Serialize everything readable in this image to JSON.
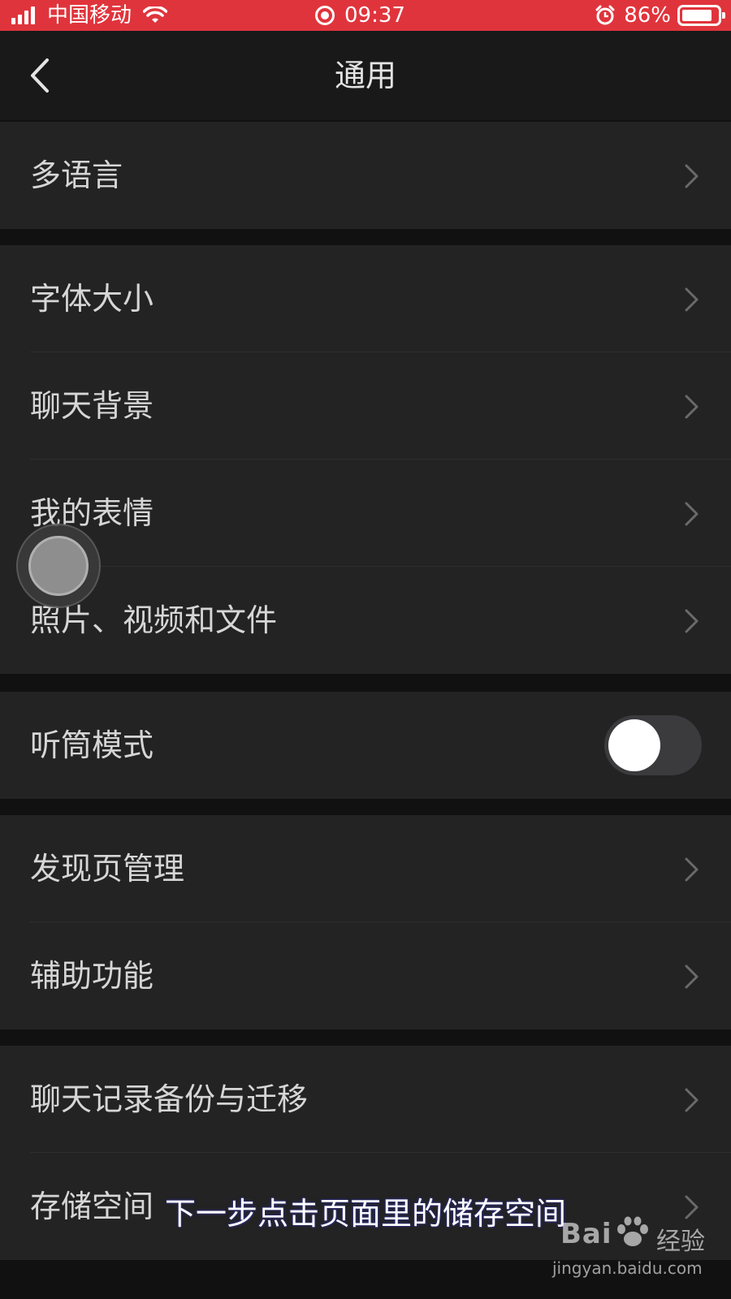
{
  "status_bar": {
    "carrier": "中国移动",
    "time": "09:37",
    "battery": "86%",
    "battery_level": 0.86
  },
  "nav": {
    "title": "通用"
  },
  "groups": [
    {
      "items": [
        {
          "label": "多语言"
        }
      ]
    },
    {
      "items": [
        {
          "label": "字体大小"
        },
        {
          "label": "聊天背景"
        },
        {
          "label": "我的表情"
        },
        {
          "label": "照片、视频和文件"
        }
      ]
    },
    {
      "items": [
        {
          "label": "听筒模式",
          "toggle": false
        }
      ]
    },
    {
      "items": [
        {
          "label": "发现页管理"
        },
        {
          "label": "辅助功能"
        }
      ]
    },
    {
      "items": [
        {
          "label": "聊天记录备份与迁移"
        },
        {
          "label": "存储空间"
        }
      ]
    }
  ],
  "caption": "下一步点击页面里的储存空间",
  "watermark": {
    "brand": "Bai",
    "suffix": "经验",
    "domain": "jingyan.baidu.com"
  },
  "colors": {
    "status_bar_bg": "#e0343c",
    "background": "#111111",
    "cell_bg": "#232323",
    "nav_bg": "#191919"
  }
}
